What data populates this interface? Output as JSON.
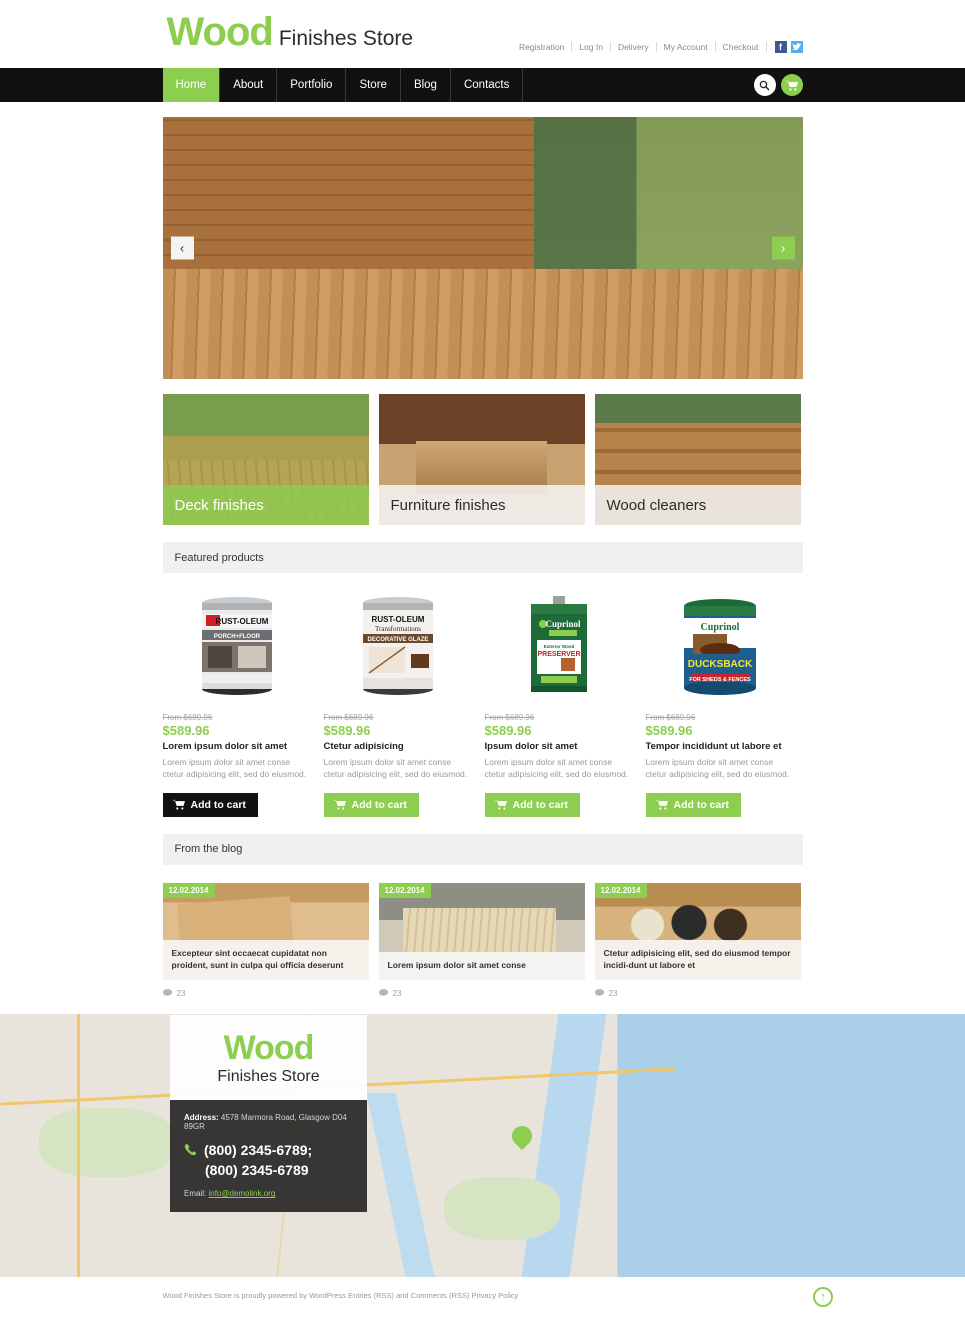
{
  "header": {
    "logo_main": "Wood",
    "logo_sub": "Finishes Store",
    "top_links": [
      "Registration",
      "Log In",
      "Delivery",
      "My Account",
      "Checkout"
    ],
    "social": [
      {
        "name": "facebook-icon",
        "glyph": "f",
        "color": "#3b5998"
      },
      {
        "name": "twitter-icon",
        "glyph": "t",
        "color": "#55acee"
      }
    ]
  },
  "nav": {
    "items": [
      {
        "label": "Home",
        "active": true
      },
      {
        "label": "About",
        "active": false
      },
      {
        "label": "Portfolio",
        "active": false
      },
      {
        "label": "Store",
        "active": false
      },
      {
        "label": "Blog",
        "active": false
      },
      {
        "label": "Contacts",
        "active": false
      }
    ],
    "search_icon": "search-icon",
    "cart_icon": "cart-icon"
  },
  "slider": {
    "prev_label": "‹",
    "next_label": "›",
    "alt": "Wooden deck with patio furniture, grill table and lounge chair"
  },
  "categories": [
    {
      "label": "Deck finishes",
      "hover": true
    },
    {
      "label": "Furniture finishes",
      "hover": false
    },
    {
      "label": "Wood cleaners",
      "hover": false
    }
  ],
  "featured": {
    "section_title": "Featured products",
    "products": [
      {
        "old_price": "From $689.96",
        "price": "$589.96",
        "title": "Lorem ipsum dolor sit amet",
        "desc": "Lorem ipsum dolor sit amet conse ctetur adipisicing elit, sed do eiusmod.",
        "button": "Add to cart",
        "button_style": "dark",
        "image": "Rust-Oleum Porch & Floor Coating can"
      },
      {
        "old_price": "From $689.96",
        "price": "$589.96",
        "title": "Ctetur adipisicing",
        "desc": "Lorem ipsum dolor sit amet conse ctetur adipisicing elit, sed do eiusmod.",
        "button": "Add to cart",
        "button_style": "green",
        "image": "Rust-Oleum Transformations Decorative Glaze can"
      },
      {
        "old_price": "From $689.96",
        "price": "$589.96",
        "title": "Ipsum dolor sit amet",
        "desc": "Lorem ipsum dolor sit amet conse ctetur adipisicing elit, sed do eiusmod.",
        "button": "Add to cart",
        "button_style": "green",
        "image": "Cuprinol Exterior Wood Preserver tin"
      },
      {
        "old_price": "From $689.96",
        "price": "$589.96",
        "title": "Tempor incididunt ut labore et",
        "desc": "Lorem ipsum dolor sit amet conse ctetur adipisicing elit, sed do eiusmod.",
        "button": "Add to cart",
        "button_style": "green",
        "image": "Cuprinol 5 Year Ducksback for Sheds & Fences tub"
      }
    ]
  },
  "blog": {
    "section_title": "From the blog",
    "posts": [
      {
        "date": "12.02.2014",
        "title": "Excepteur sint occaecat cupidatat non proident, sunt in culpa qui officia deserunt",
        "comments": "23",
        "image": "Person sanding a wooden board"
      },
      {
        "date": "12.02.2014",
        "title": "Lorem ipsum dolor sit amet conse",
        "comments": "23",
        "image": "Wooden adirondack chairs on gravel"
      },
      {
        "date": "12.02.2014",
        "title": "Ctetur adipisicing elit, sed do eiusmod tempor incidi-dunt ut labore et",
        "comments": "23",
        "image": "Three paint cans on a wooden floor"
      }
    ]
  },
  "contact": {
    "logo_main": "Wood",
    "logo_sub": "Finishes Store",
    "address_label": "Address:",
    "address": "4578 Marmora Road, Glasgow D04 89GR",
    "phone1": "(800) 2345-6789;",
    "phone2": "(800) 2345-6789",
    "email_label": "Email:",
    "email": "info@demolink.org",
    "phone_icon": "phone-icon",
    "map_pin_icon": "map-pin-icon"
  },
  "footer": {
    "copyright": "Wood Finishes Store is proudly powered by WordPress Entries (RSS) and Comments (RSS) Privacy Policy",
    "to_top_icon": "arrow-up-icon"
  },
  "colors": {
    "accent_green": "#8dcd50",
    "dark": "#111111",
    "muted": "#9a9a9a"
  }
}
